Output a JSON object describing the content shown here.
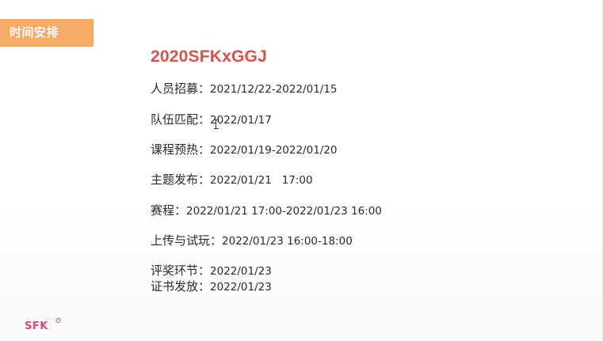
{
  "section_tag": "时间安排",
  "title": "2020SFKxGGJ",
  "schedule": [
    {
      "label": "人员招募：",
      "value": "2021/12/22-2022/01/15"
    },
    {
      "label": "队伍匹配：",
      "value": "2022/01/17"
    },
    {
      "label": "课程预热：",
      "value": "2022/01/19-2022/01/20"
    },
    {
      "label": "主题发布：",
      "value": "2022/01/21   17:00"
    },
    {
      "label": "赛程：",
      "value": "2022/01/21 17:00-2022/01/23 16:00"
    },
    {
      "label": "上传与试玩：",
      "value": "2022/01/23 16:00-18:00"
    },
    {
      "label": "评奖环节：",
      "value": "2022/01/23"
    },
    {
      "label": "证书发放：",
      "value": "2022/01/23"
    }
  ],
  "logo": {
    "text": "SFK",
    "icon": "sfk-logo-icon",
    "color": "#e8457a"
  },
  "colors": {
    "tag_bg": "#f4ab68",
    "title": "#d9534a",
    "text": "#2b2b2b"
  }
}
